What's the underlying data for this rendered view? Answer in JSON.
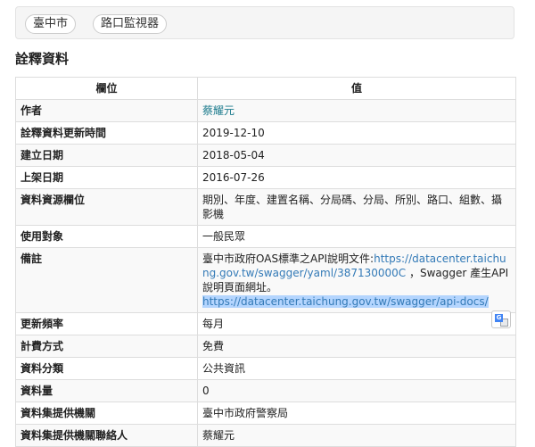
{
  "tags": [
    "臺中市",
    "路口監視器"
  ],
  "section_title": "詮釋資料",
  "table": {
    "headers": {
      "field": "欄位",
      "value": "值"
    },
    "rows": [
      {
        "field": "作者",
        "value": "蔡耀元"
      },
      {
        "field": "詮釋資料更新時間",
        "value": "2019-12-10"
      },
      {
        "field": "建立日期",
        "value": "2018-05-04"
      },
      {
        "field": "上架日期",
        "value": "2016-07-26"
      },
      {
        "field": "資料資源欄位",
        "value": "期別、年度、建置名稱、分局碼、分局、所別、路口、組數、攝影機"
      },
      {
        "field": "使用對象",
        "value": "一般民眾"
      },
      {
        "field": "備註",
        "value": ""
      },
      {
        "field": "更新頻率",
        "value": "每月"
      },
      {
        "field": "計費方式",
        "value": "免費"
      },
      {
        "field": "資料分類",
        "value": "公共資訊"
      },
      {
        "field": "資料量",
        "value": "0"
      },
      {
        "field": "資料集提供機關",
        "value": "臺中市政府警察局"
      },
      {
        "field": "資料集提供機關聯絡人",
        "value": "蔡耀元"
      }
    ],
    "note": {
      "text_before": "臺中市政府OAS標準之API說明文件:",
      "link1": "https://datacenter.taichung.gov.tw/swagger/yaml/387130000C",
      "text_middle": " ，Swagger 產生API說明頁面網址。",
      "link2": "https://datacenter.taichung.gov.tw/swagger/api-docs/"
    }
  },
  "icons": {
    "translate": "google-translate-icon"
  }
}
